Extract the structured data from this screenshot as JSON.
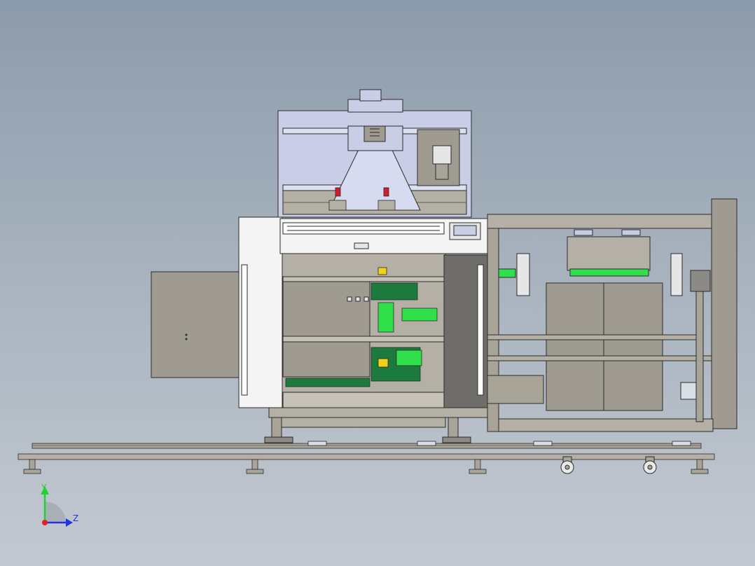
{
  "viewport": {
    "background_top": "#8c9bab",
    "background_bottom": "#c3c9d1"
  },
  "colors": {
    "frame_gray": "#b5b0a5",
    "steel_gray": "#a8a498",
    "panel_tan": "#a09b90",
    "dark_panel": "#6e6d6a",
    "white_panel": "#f4f4f4",
    "lavender": "#c9cde6",
    "accent_green": "#2fe04a",
    "dark_green": "#1c7a3d",
    "accent_red": "#d21d2b",
    "accent_yellow": "#f0d21c",
    "line_dark": "#2b2b2b"
  },
  "triad": {
    "y_label": "Y",
    "z_label": "Z",
    "y_color": "#22d12e",
    "z_color": "#2433e0",
    "x_color": "#e0222a"
  }
}
